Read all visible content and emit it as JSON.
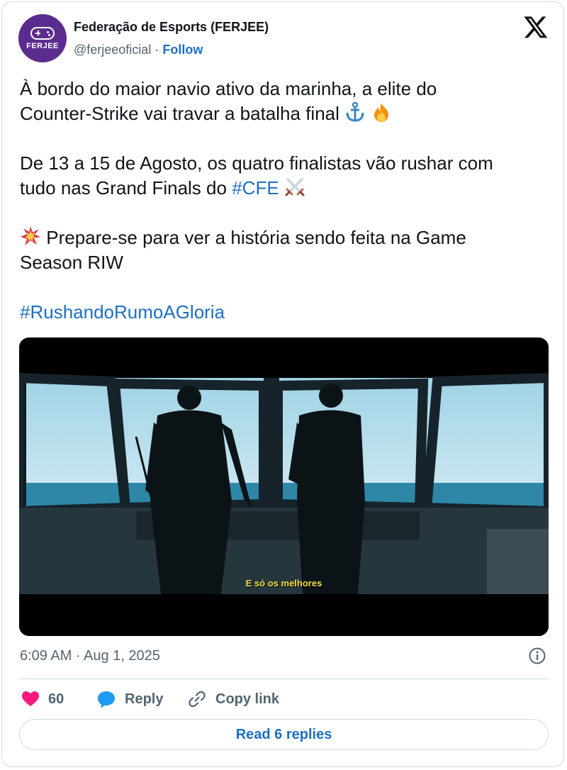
{
  "author": {
    "name": "Federação de Esports (FERJEE)",
    "handle": "@ferjeeoficial",
    "separator": "·",
    "follow_label": "Follow",
    "avatar_text": "FERJEE"
  },
  "tweet": {
    "line1_a": "À bordo do maior navio ativo da marinha, a elite do",
    "line1_b": "Counter-Strike vai travar a batalha final",
    "p2_a": "De 13 a 15 de Agosto, os quatro finalistas vão rushar com",
    "p2_b": "tudo nas Grand Finals do",
    "p2_tag": "#CFE",
    "p3_a": "Prepare-se para ver a história sendo feita na Game",
    "p3_b": "Season RIW",
    "p4_tag": "#RushandoRumoAGloria"
  },
  "media": {
    "subtitle": "E só os melhores"
  },
  "meta": {
    "timestamp": "6:09 AM · Aug 1, 2025"
  },
  "actions": {
    "likes_count": "60",
    "reply_label": "Reply",
    "copy_label": "Copy link",
    "read_replies_label": "Read 6 replies"
  },
  "colors": {
    "link": "#1d6fc2",
    "like_heart": "#f91880",
    "reply_bubble": "#1d9bf0",
    "avatar_bg": "#5b2c8f"
  },
  "icons": [
    "x-logo-icon",
    "anchor-emoji",
    "fire-emoji",
    "crossed-swords-emoji",
    "collision-emoji",
    "info-icon",
    "heart-icon",
    "reply-icon",
    "link-icon"
  ]
}
